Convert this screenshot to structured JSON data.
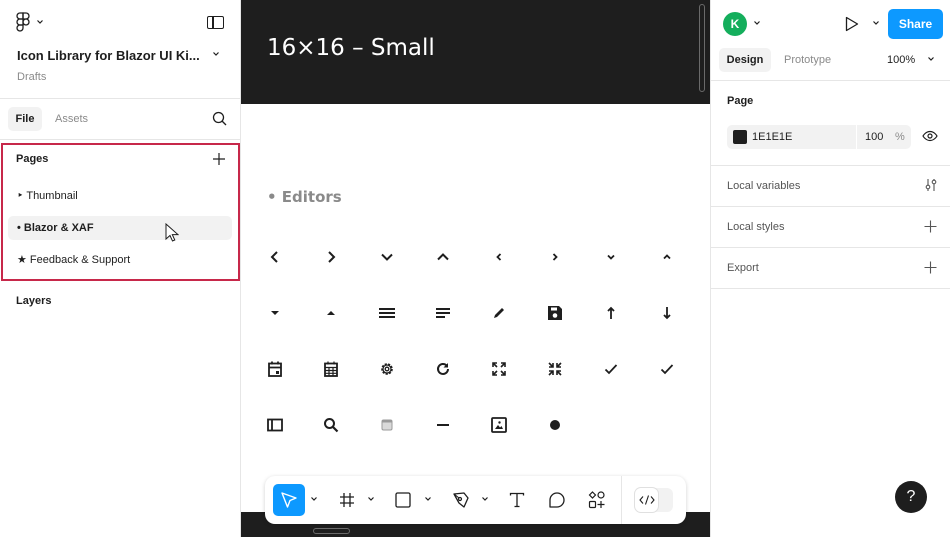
{
  "left_panel": {
    "file_title": "Icon Library for Blazor UI Ki...",
    "location": "Drafts",
    "tabs": {
      "file": "File",
      "assets": "Assets"
    },
    "pages_label": "Pages",
    "pages": [
      {
        "label": "‣ Thumbnail",
        "selected": false
      },
      {
        "label": "• Blazor & XAF",
        "selected": true
      },
      {
        "label": "★ Feedback & Support",
        "selected": false
      }
    ],
    "layers_label": "Layers"
  },
  "canvas": {
    "frame_title": "16×16 – Small",
    "section_label": "• Editors",
    "icon_rows": [
      [
        "chevron-left",
        "chevron-right",
        "chevron-down",
        "chevron-up",
        "chevron-left-small",
        "chevron-right-small",
        "chevron-down-small",
        "chevron-up-small"
      ],
      [
        "caret-down",
        "caret-up",
        "menu",
        "align-left",
        "pencil",
        "save",
        "arrow-up",
        "arrow-down"
      ],
      [
        "calendar-day",
        "calendar",
        "gear",
        "refresh",
        "expand",
        "collapse",
        "check",
        "check"
      ],
      [
        "sidebar",
        "search",
        "window",
        "minus",
        "image",
        "dot"
      ]
    ],
    "toolbar": {
      "tools": [
        "move",
        "frame",
        "rectangle",
        "pen",
        "text",
        "comment",
        "actions"
      ],
      "active_tool": "move",
      "dev_mode_label": "</>"
    }
  },
  "right_panel": {
    "avatar_initial": "K",
    "avatar_color": "#14ae5c",
    "share_label": "Share",
    "accent_color": "#0d99ff",
    "tabs": {
      "design": "Design",
      "prototype": "Prototype"
    },
    "zoom": "100%",
    "page_section": {
      "label": "Page",
      "fill_hex": "1E1E1E",
      "fill_color": "#1e1e1e",
      "opacity": "100",
      "opacity_unit": "%"
    },
    "sections": [
      {
        "label": "Local variables",
        "icon": "sliders"
      },
      {
        "label": "Local styles",
        "icon": "plus"
      },
      {
        "label": "Export",
        "icon": "plus"
      }
    ],
    "help_label": "?"
  },
  "highlight_color": "#c7284a"
}
